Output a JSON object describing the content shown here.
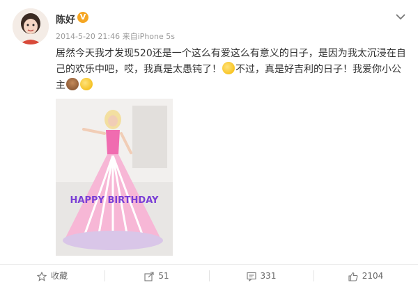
{
  "user": {
    "name": "陈好",
    "verified_badge": "V"
  },
  "post": {
    "date": "2014-5-20 21:46",
    "source": "来自iPhone 5s",
    "text_1": "居然今天我才发现520还是一个这么有爱这么有意义的日子，是因为我太沉浸在自己的欢乐中吧，哎，我真是太愚钝了！",
    "text_2": "不过，真是好吉利的日子！我爱你小公主",
    "emoji_1": "blush-emoji",
    "emoji_2": "cake-emoji",
    "emoji_3": "shy-eyes-emoji",
    "image_text": "HAPPY BIRTHDAY"
  },
  "actions": {
    "favorite_label": "收藏",
    "repost_count": "51",
    "comment_count": "331",
    "like_count": "2104"
  },
  "colors": {
    "badge": "#f5a623",
    "text": "#333333",
    "meta": "#999999"
  }
}
